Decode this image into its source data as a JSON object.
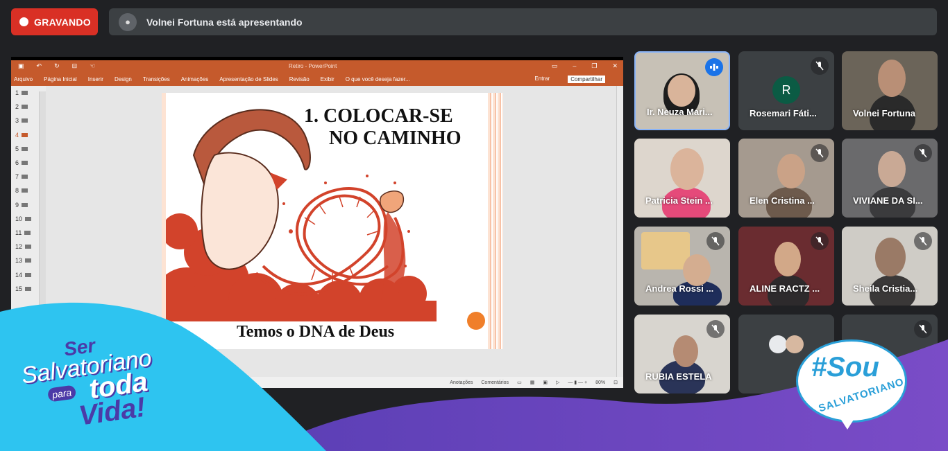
{
  "recording": {
    "label": "GRAVANDO"
  },
  "presenter": {
    "text": "Volnei Fortuna está apresentando"
  },
  "ppt": {
    "window_title": "Retiro - PowerPoint",
    "menu": [
      "Arquivo",
      "Página Inicial",
      "Inserir",
      "Design",
      "Transições",
      "Animações",
      "Apresentação de Slides",
      "Revisão",
      "Exibir",
      "O que você deseja fazer..."
    ],
    "enter": "Entrar",
    "share": "Compartilhar",
    "slide_numbers": [
      "1",
      "2",
      "3",
      "4",
      "5",
      "6",
      "7",
      "8",
      "9",
      "10",
      "11",
      "12",
      "13",
      "14",
      "15"
    ],
    "active_slide": "4",
    "slide_title_line1": "1.  COLOCAR-SE",
    "slide_title_line2": "NO CAMINHO",
    "slide_footer": "Temos o DNA de Deus",
    "status_notes": "Anotações",
    "status_comments": "Comentários",
    "zoom": "80%"
  },
  "participants": [
    {
      "name": "Ir. Neuza Mari...",
      "speaking": true
    },
    {
      "name": "Rosemari Fáti...",
      "initial": "R",
      "muted": true
    },
    {
      "name": "Volnei Fortuna"
    },
    {
      "name": "Patricia Stein ..."
    },
    {
      "name": "Elen Cristina ...",
      "muted": true
    },
    {
      "name": "VIVIANE DA SI...",
      "muted": true
    },
    {
      "name": "Andrea Rossi ...",
      "muted": true
    },
    {
      "name": "ALINE RACTZ ...",
      "muted": true
    },
    {
      "name": "Sheila Cristia...",
      "muted": true
    },
    {
      "name": "RUBIA ESTELA",
      "muted": true
    },
    {
      "name": "",
      "muted": false
    },
    {
      "name": "",
      "muted": true
    }
  ],
  "branding": {
    "left_l1": "Ser",
    "left_l2": "Salvatoriano",
    "left_l3": "para",
    "left_l4": "toda",
    "left_l5": "Vida!",
    "right_l1": "#Sou",
    "right_l2": "SALVATORIANO"
  },
  "colors": {
    "record": "#d93025",
    "ppt_accent": "#c55a2c",
    "active_tile": "#8ab4f8",
    "brand_cyan": "#2ec4f0",
    "brand_purple": "#4b3aa7"
  }
}
